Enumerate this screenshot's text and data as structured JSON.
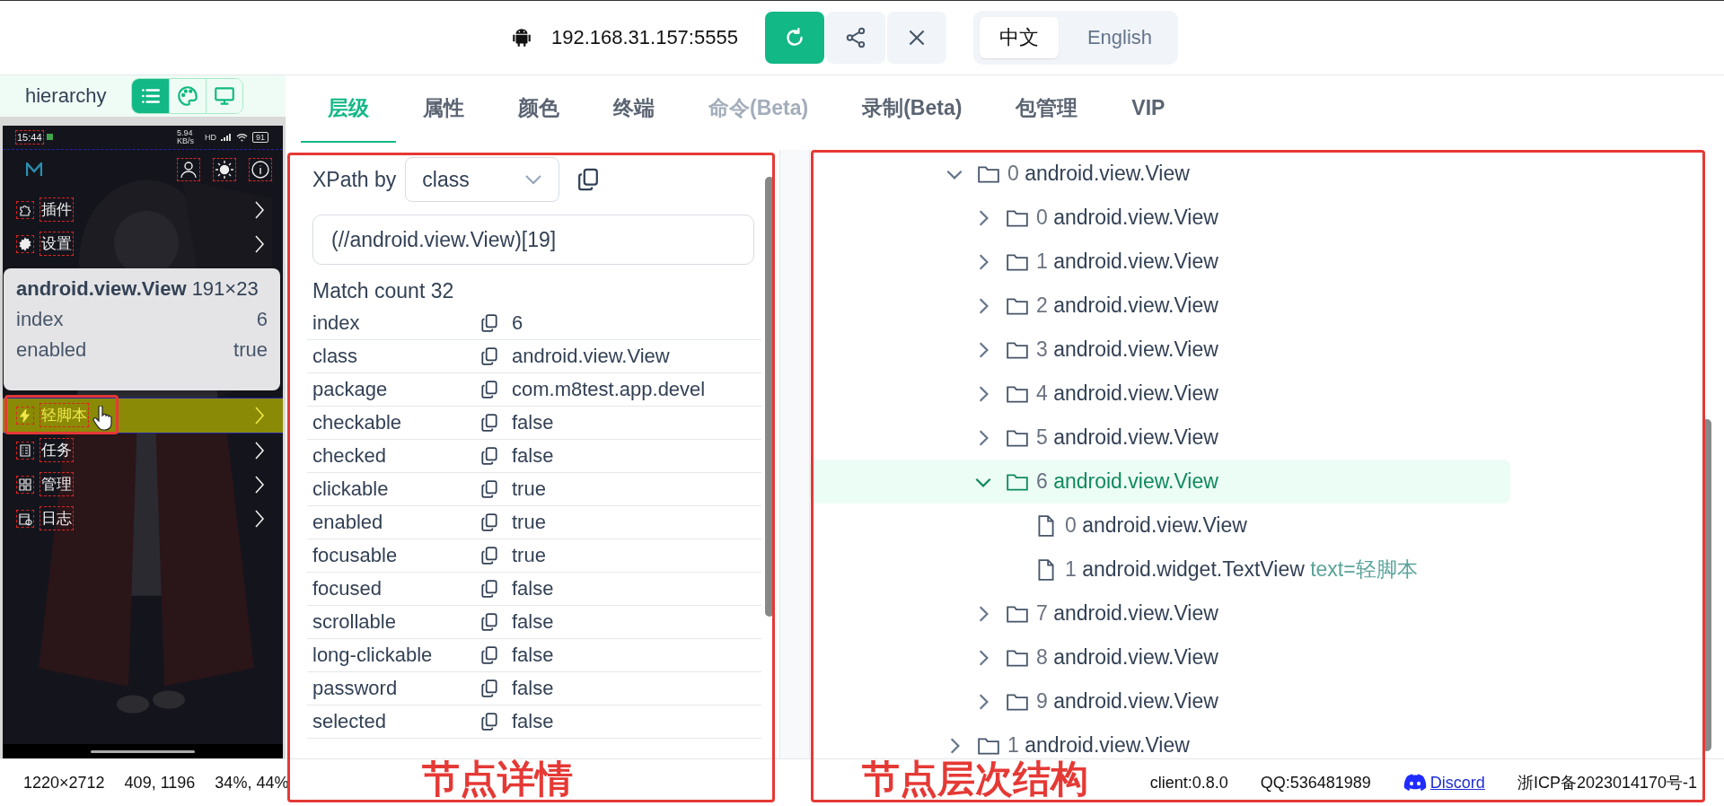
{
  "top_bar": {
    "device": "192.168.31.157:5555",
    "actions": [
      {
        "kind": "refresh"
      },
      {
        "kind": "share"
      },
      {
        "kind": "close"
      }
    ],
    "languages": [
      {
        "label": "中文",
        "selected": true
      },
      {
        "label": "English",
        "selected": false
      }
    ]
  },
  "left_panel": {
    "title": "hierarchy",
    "view_modes": [
      {
        "kind": "list",
        "selected": true
      },
      {
        "kind": "palette",
        "selected": false
      },
      {
        "kind": "screen",
        "selected": false
      }
    ]
  },
  "phone": {
    "time": "15:44",
    "net_speed": "5.94 KB/s",
    "network": "HD",
    "battery": "91",
    "menu": [
      {
        "label": "插件",
        "kind": "plugin",
        "selected": false,
        "annotated": false
      },
      {
        "label": "设置",
        "kind": "gear",
        "selected": false,
        "annotated": false
      },
      {
        "label": "轻脚本",
        "kind": "bolt",
        "selected": true,
        "annotated": true
      },
      {
        "label": "任务",
        "kind": "task",
        "selected": false,
        "annotated": false
      },
      {
        "label": "管理",
        "kind": "manage",
        "selected": false,
        "annotated": false
      },
      {
        "label": "日志",
        "kind": "log",
        "selected": false,
        "annotated": false
      }
    ]
  },
  "tooltip": {
    "title": "android.view.View",
    "size": "191×23",
    "rows": [
      {
        "name": "index",
        "value": "6"
      },
      {
        "name": "enabled",
        "value": "true"
      }
    ]
  },
  "screen_info": [
    "1220×2712",
    "409, 1196",
    "34%, 44%"
  ],
  "tabs": [
    {
      "label": "层级",
      "selected": true,
      "disabled": false
    },
    {
      "label": "属性",
      "selected": false,
      "disabled": false
    },
    {
      "label": "颜色",
      "selected": false,
      "disabled": false
    },
    {
      "label": "终端",
      "selected": false,
      "disabled": false
    },
    {
      "label": "命令(Beta)",
      "selected": false,
      "disabled": true
    },
    {
      "label": "录制(Beta)",
      "selected": false,
      "disabled": false
    },
    {
      "label": "包管理",
      "selected": false,
      "disabled": false
    },
    {
      "label": "VIP",
      "selected": false,
      "disabled": false
    }
  ],
  "details": {
    "xpath_label": "XPath by",
    "xpath_mode": "class",
    "xpath": "(//android.view.View)[19]",
    "match_count": "Match count 32",
    "annotation_label": "节点详情",
    "properties": [
      {
        "name": "index",
        "value": "6"
      },
      {
        "name": "class",
        "value": "android.view.View"
      },
      {
        "name": "package",
        "value": "com.m8test.app.devel"
      },
      {
        "name": "checkable",
        "value": "false"
      },
      {
        "name": "checked",
        "value": "false"
      },
      {
        "name": "clickable",
        "value": "true"
      },
      {
        "name": "enabled",
        "value": "true"
      },
      {
        "name": "focusable",
        "value": "true"
      },
      {
        "name": "focused",
        "value": "false"
      },
      {
        "name": "scrollable",
        "value": "false"
      },
      {
        "name": "long-clickable",
        "value": "false"
      },
      {
        "name": "password",
        "value": "false"
      },
      {
        "name": "selected",
        "value": "false"
      }
    ]
  },
  "tree": {
    "annotation_label": "节点层次结构",
    "nodes": [
      {
        "index": "0",
        "class": "android.view.View",
        "kind": "folder",
        "expanded": true,
        "selected": false,
        "children": [
          {
            "index": "0",
            "class": "android.view.View",
            "kind": "folder",
            "expanded": false,
            "selected": false
          },
          {
            "index": "1",
            "class": "android.view.View",
            "kind": "folder",
            "expanded": false,
            "selected": false
          },
          {
            "index": "2",
            "class": "android.view.View",
            "kind": "folder",
            "expanded": false,
            "selected": false
          },
          {
            "index": "3",
            "class": "android.view.View",
            "kind": "folder",
            "expanded": false,
            "selected": false
          },
          {
            "index": "4",
            "class": "android.view.View",
            "kind": "folder",
            "expanded": false,
            "selected": false
          },
          {
            "index": "5",
            "class": "android.view.View",
            "kind": "folder",
            "expanded": false,
            "selected": false
          },
          {
            "index": "6",
            "class": "android.view.View",
            "kind": "folder",
            "expanded": true,
            "selected": true,
            "children": [
              {
                "index": "0",
                "class": "android.view.View",
                "kind": "file",
                "expanded": false,
                "selected": false
              },
              {
                "index": "1",
                "class": "android.widget.TextView",
                "text": "text=轻脚本",
                "kind": "file",
                "expanded": false,
                "selected": false
              }
            ]
          },
          {
            "index": "7",
            "class": "android.view.View",
            "kind": "folder",
            "expanded": false,
            "selected": false
          },
          {
            "index": "8",
            "class": "android.view.View",
            "kind": "folder",
            "expanded": false,
            "selected": false
          },
          {
            "index": "9",
            "class": "android.view.View",
            "kind": "folder",
            "expanded": false,
            "selected": false
          }
        ]
      },
      {
        "index": "1",
        "class": "android.view.View",
        "kind": "folder",
        "expanded": false,
        "selected": false
      }
    ]
  },
  "footer": {
    "client": "client:0.8.0",
    "qq": "QQ:536481989",
    "discord": "Discord",
    "icp": "浙ICP备2023014170号-1"
  }
}
